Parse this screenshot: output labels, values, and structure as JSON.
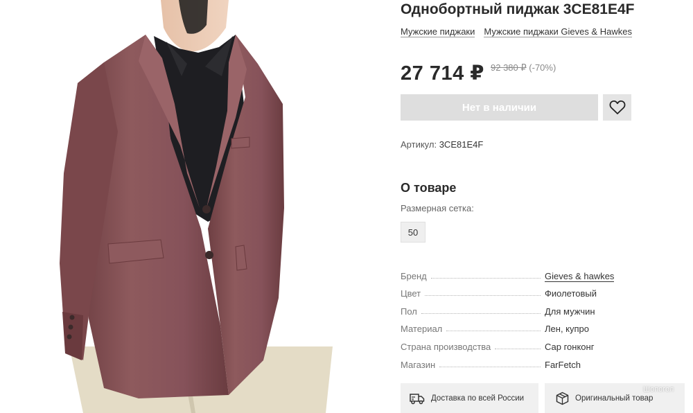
{
  "product": {
    "title": "Однобортный пиджак 3CE81E4F",
    "breadcrumbs": [
      "Мужские пиджаки",
      "Мужские пиджаки Gieves & Hawkes"
    ],
    "price": "27 714 ₽",
    "old_price": "92 380 ₽",
    "discount": "(-70%)",
    "stock_button": "Нет в наличии",
    "sku_label": "Артикул:",
    "sku_value": "3CE81E4F"
  },
  "about": {
    "title": "О товаре",
    "size_label": "Размерная сетка:",
    "sizes": [
      "50"
    ]
  },
  "specs": [
    {
      "key": "Бренд",
      "value": "Gieves & hawkes"
    },
    {
      "key": "Цвет",
      "value": "Фиолетовый"
    },
    {
      "key": "Пол",
      "value": "Для мужчин"
    },
    {
      "key": "Материал",
      "value": "Лен, купро"
    },
    {
      "key": "Страна производства",
      "value": "Сар гонконг"
    },
    {
      "key": "Магазин",
      "value": "FarFetch"
    }
  ],
  "features": {
    "delivery": "Доставка по всей России",
    "original": "Оригинальный товар"
  },
  "watermark": "Шопогол",
  "icons": {
    "favorite": "heart-icon",
    "delivery": "truck-icon",
    "original": "box-icon"
  },
  "colors": {
    "jacket": "#8a5558",
    "shirt": "#1e1e22",
    "trousers": "#e4dcc6",
    "skin": "#e8c7b0",
    "disabled_button": "#dedede"
  }
}
